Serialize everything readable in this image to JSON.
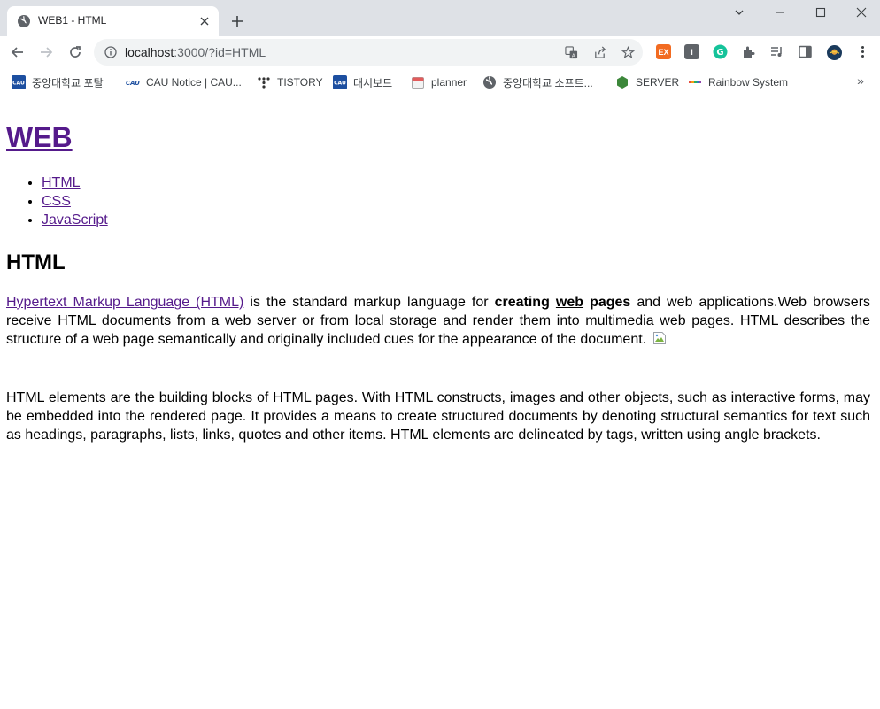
{
  "browser": {
    "tab_title": "WEB1 - HTML",
    "url_host": "localhost",
    "url_rest": ":3000/?id=HTML"
  },
  "bookmarks": [
    {
      "label": "중앙대학교 포탈",
      "icon": "cau-logo-icon"
    },
    {
      "label": "CAU Notice | CAU...",
      "icon": "cau-notice-icon"
    },
    {
      "label": "TISTORY",
      "icon": "tistory-icon"
    },
    {
      "label": "대시보드",
      "icon": "cau-logo-icon"
    },
    {
      "label": "planner",
      "icon": "calendar-icon"
    },
    {
      "label": "중앙대학교 소프트...",
      "icon": "globe-icon"
    },
    {
      "label": "SERVER",
      "icon": "nodejs-icon"
    },
    {
      "label": "Rainbow System",
      "icon": "rainbow-icon"
    }
  ],
  "page": {
    "site_title": "WEB",
    "nav": [
      "HTML",
      "CSS",
      "JavaScript"
    ],
    "heading": "HTML",
    "p1": {
      "link_text": "Hypertext Markup Language (HTML)",
      "text_1": " is the standard markup language for ",
      "bold_1": "creating ",
      "bold_underline": "web",
      "bold_2": " pages",
      "text_2": " and web applications.Web browsers receive HTML documents from a web server or from local storage and render them into multimedia web pages. HTML describes the structure of a web page semantically and originally included cues for the appearance of the document. "
    },
    "p2": "HTML elements are the building blocks of HTML pages. With HTML constructs, images and other objects, such as interactive forms, may be embedded into the rendered page. It provides a means to create structured documents by denoting structural semantics for text such as headings, paragraphs, lists, links, quotes and other items. HTML elements are delineated by tags, written using angle brackets."
  }
}
